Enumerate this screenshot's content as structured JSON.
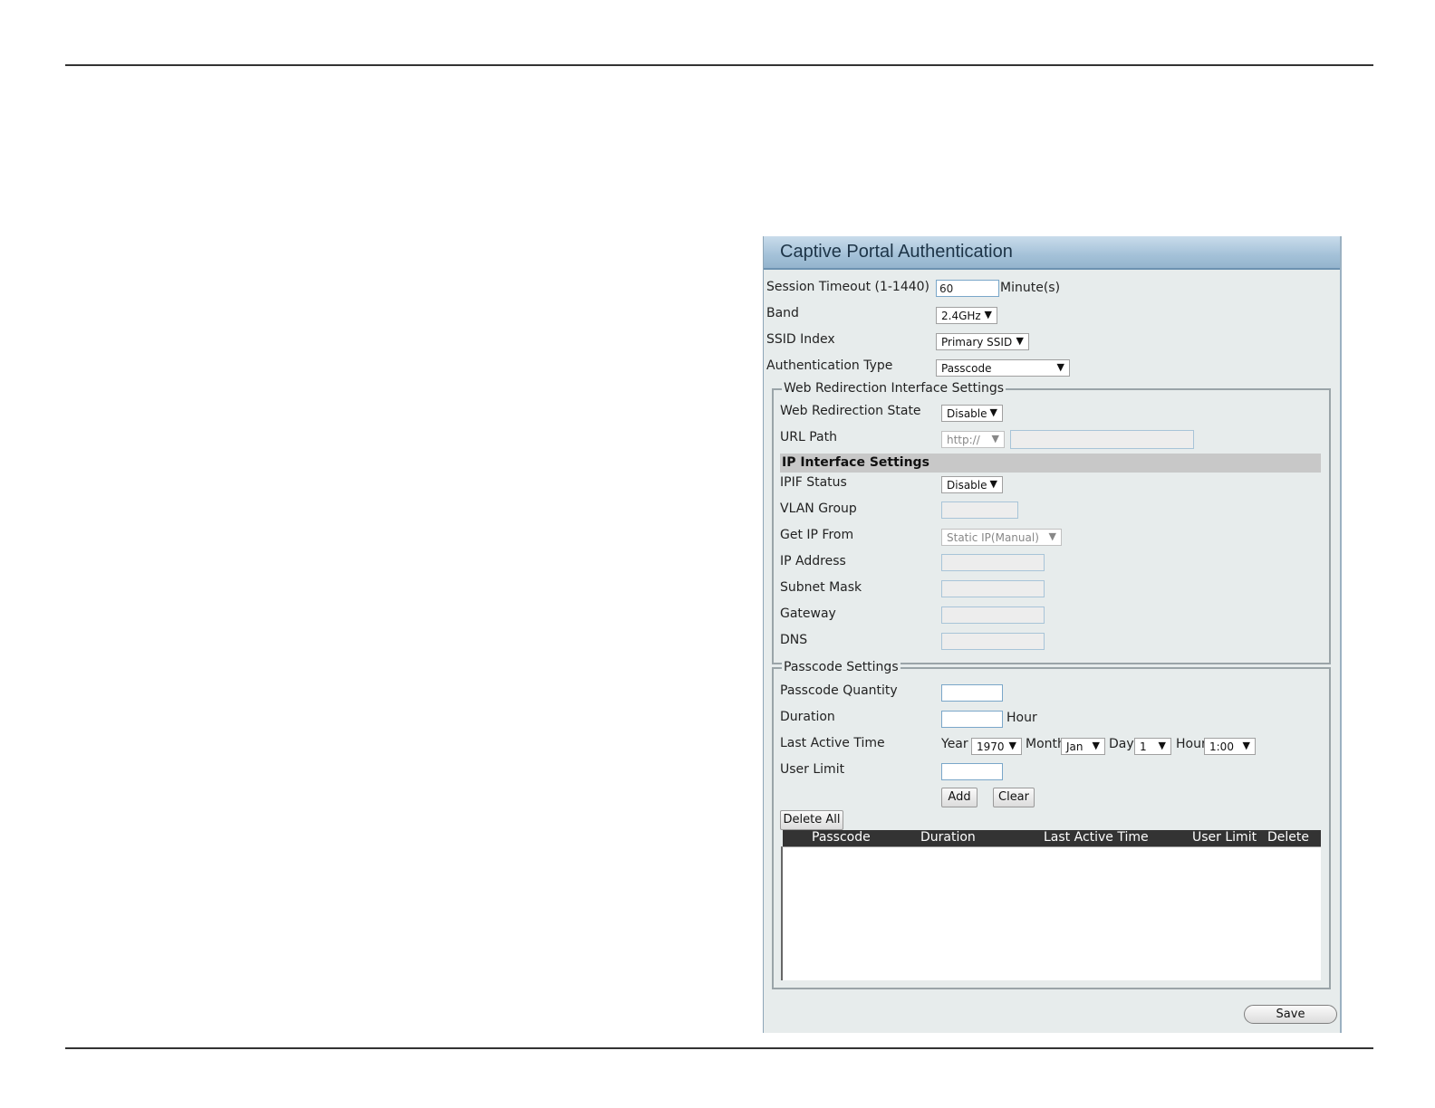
{
  "panel": {
    "title": "Captive Portal Authentication",
    "session_timeout": {
      "label": "Session Timeout (1-1440)",
      "value": "60",
      "unit": "Minute(s)"
    },
    "band": {
      "label": "Band",
      "value": "2.4GHz"
    },
    "ssid_index": {
      "label": "SSID Index",
      "value": "Primary SSID"
    },
    "auth_type": {
      "label": "Authentication Type",
      "value": "Passcode"
    }
  },
  "web_redirection": {
    "legend": "Web Redirection Interface Settings",
    "state": {
      "label": "Web Redirection State",
      "value": "Disable"
    },
    "url_path": {
      "label": "URL Path",
      "protocol": "http://",
      "value": ""
    }
  },
  "ip_interface": {
    "heading": "IP Interface Settings",
    "ipif_status": {
      "label": "IPIF Status",
      "value": "Disable"
    },
    "vlan_group": {
      "label": "VLAN Group",
      "value": ""
    },
    "get_ip_from": {
      "label": "Get IP From",
      "value": "Static IP(Manual)"
    },
    "ip_address": {
      "label": "IP Address",
      "value": ""
    },
    "subnet_mask": {
      "label": "Subnet Mask",
      "value": ""
    },
    "gateway": {
      "label": "Gateway",
      "value": ""
    },
    "dns": {
      "label": "DNS",
      "value": ""
    }
  },
  "passcode": {
    "legend": "Passcode Settings",
    "quantity": {
      "label": "Passcode Quantity",
      "value": ""
    },
    "duration": {
      "label": "Duration",
      "value": "",
      "unit": "Hour"
    },
    "last_active": {
      "label": "Last Active Time",
      "year_label": "Year",
      "year": "1970",
      "month_label": "Month",
      "month": "Jan",
      "day_label": "Day",
      "day": "1",
      "hour_label": "Hour",
      "hour": "1:00"
    },
    "user_limit": {
      "label": "User Limit",
      "value": ""
    },
    "add_label": "Add",
    "clear_label": "Clear",
    "delete_all_label": "Delete All",
    "table": {
      "columns": [
        "Passcode",
        "Duration",
        "Last Active Time",
        "User Limit",
        "Delete"
      ],
      "rows": []
    }
  },
  "save_label": "Save"
}
